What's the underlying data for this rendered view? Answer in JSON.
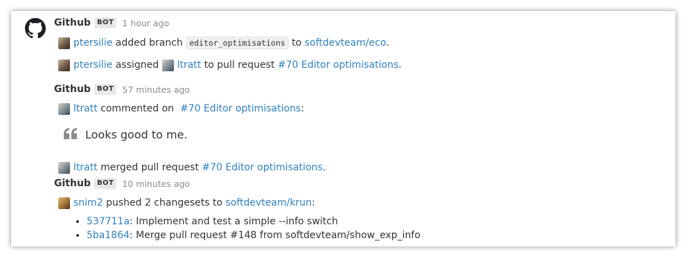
{
  "messages": [
    {
      "sender": "Github",
      "badge": "BOT",
      "time": "1 hour ago",
      "events": [
        {
          "user": "ptersilie",
          "action": "added branch",
          "branch": "editor_optimisations",
          "to": "to",
          "repo": "softdevteam/eco",
          "end": "."
        },
        {
          "user": "ptersilie",
          "action": "assigned",
          "assignee": "ltratt",
          "to": "to pull request",
          "pr": "#70 Editor optimisations",
          "end": "."
        }
      ]
    },
    {
      "sender": "Github",
      "badge": "BOT",
      "time": "57 minutes ago",
      "comment": {
        "user": "ltratt",
        "action": "commented on",
        "pr": "#70 Editor optimisations",
        "end": ":"
      },
      "quote": "Looks good to me.",
      "merge": {
        "user": "ltratt",
        "action": "merged pull request",
        "pr": "#70 Editor optimisations",
        "end": "."
      }
    },
    {
      "sender": "Github",
      "badge": "BOT",
      "time": "10 minutes ago",
      "push": {
        "user": "snim2",
        "action": "pushed 2 changesets to",
        "repo": "softdevteam/krun",
        "end": ":"
      },
      "commits": [
        {
          "hash": "537711a",
          "message": ": Implement and test a simple --info switch"
        },
        {
          "hash": "5ba1864",
          "message": ": Merge pull request #148 from softdevteam/show_exp_info"
        }
      ]
    }
  ],
  "colors": {
    "link": "#2f7fbd",
    "text": "#333333",
    "time": "#8a8a8a",
    "badge_bg": "#e9e9e9"
  },
  "icons": {
    "sender_avatar": "github-octocat-icon",
    "quote": "quote-icon"
  }
}
